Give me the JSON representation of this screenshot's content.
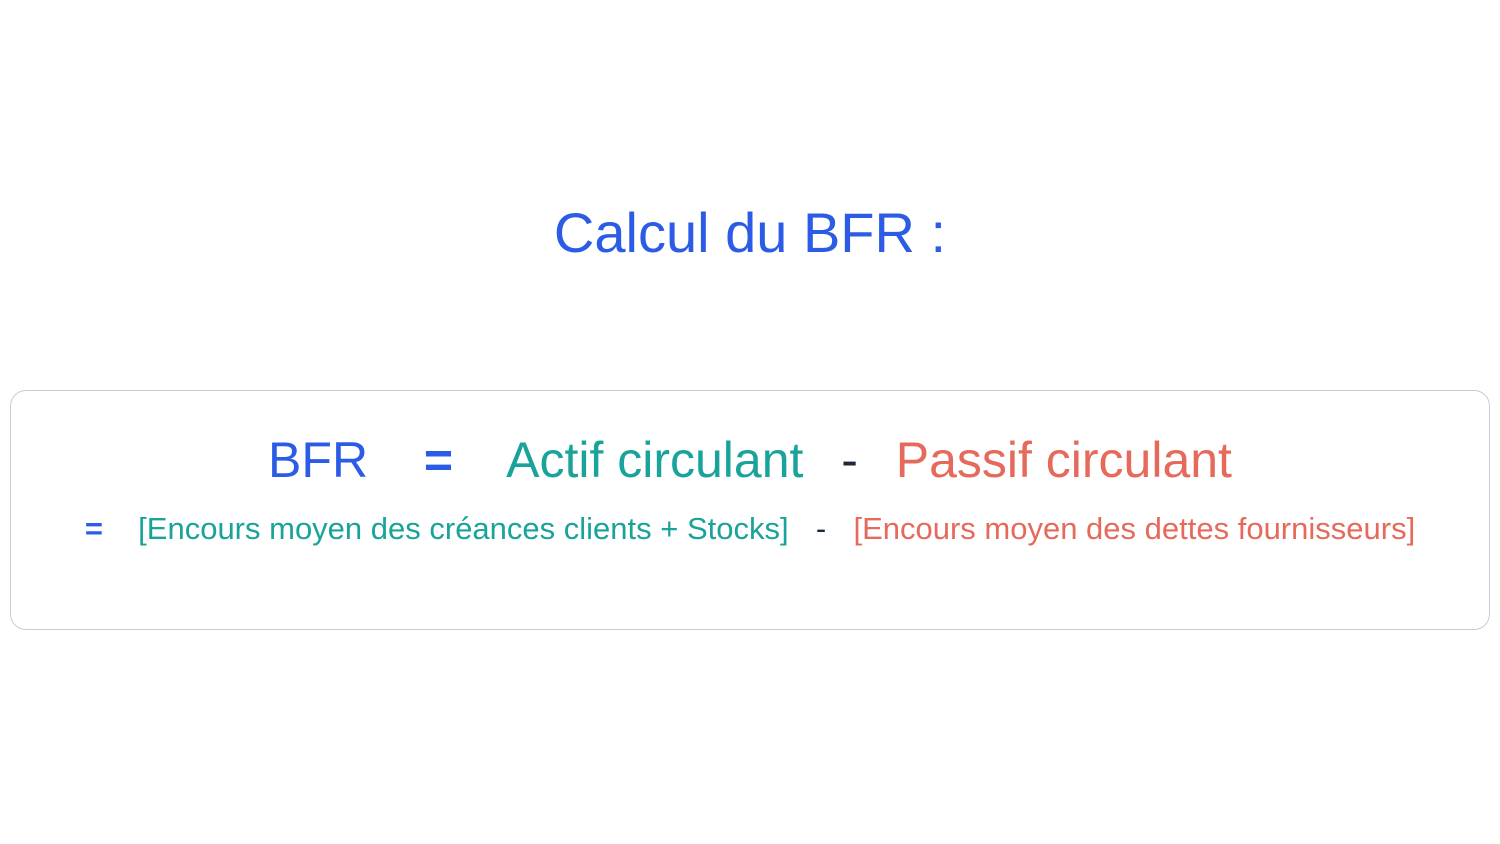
{
  "title": "Calcul du BFR :",
  "formula": {
    "line1": {
      "bfr": "BFR",
      "equals": "=",
      "actif": "Actif circulant",
      "minus": "-",
      "passif": "Passif circulant"
    },
    "line2": {
      "equals": "=",
      "actif_detail": "[Encours moyen des créances clients + Stocks]",
      "minus": "-",
      "passif_detail": "[Encours moyen des dettes fournisseurs]"
    }
  }
}
